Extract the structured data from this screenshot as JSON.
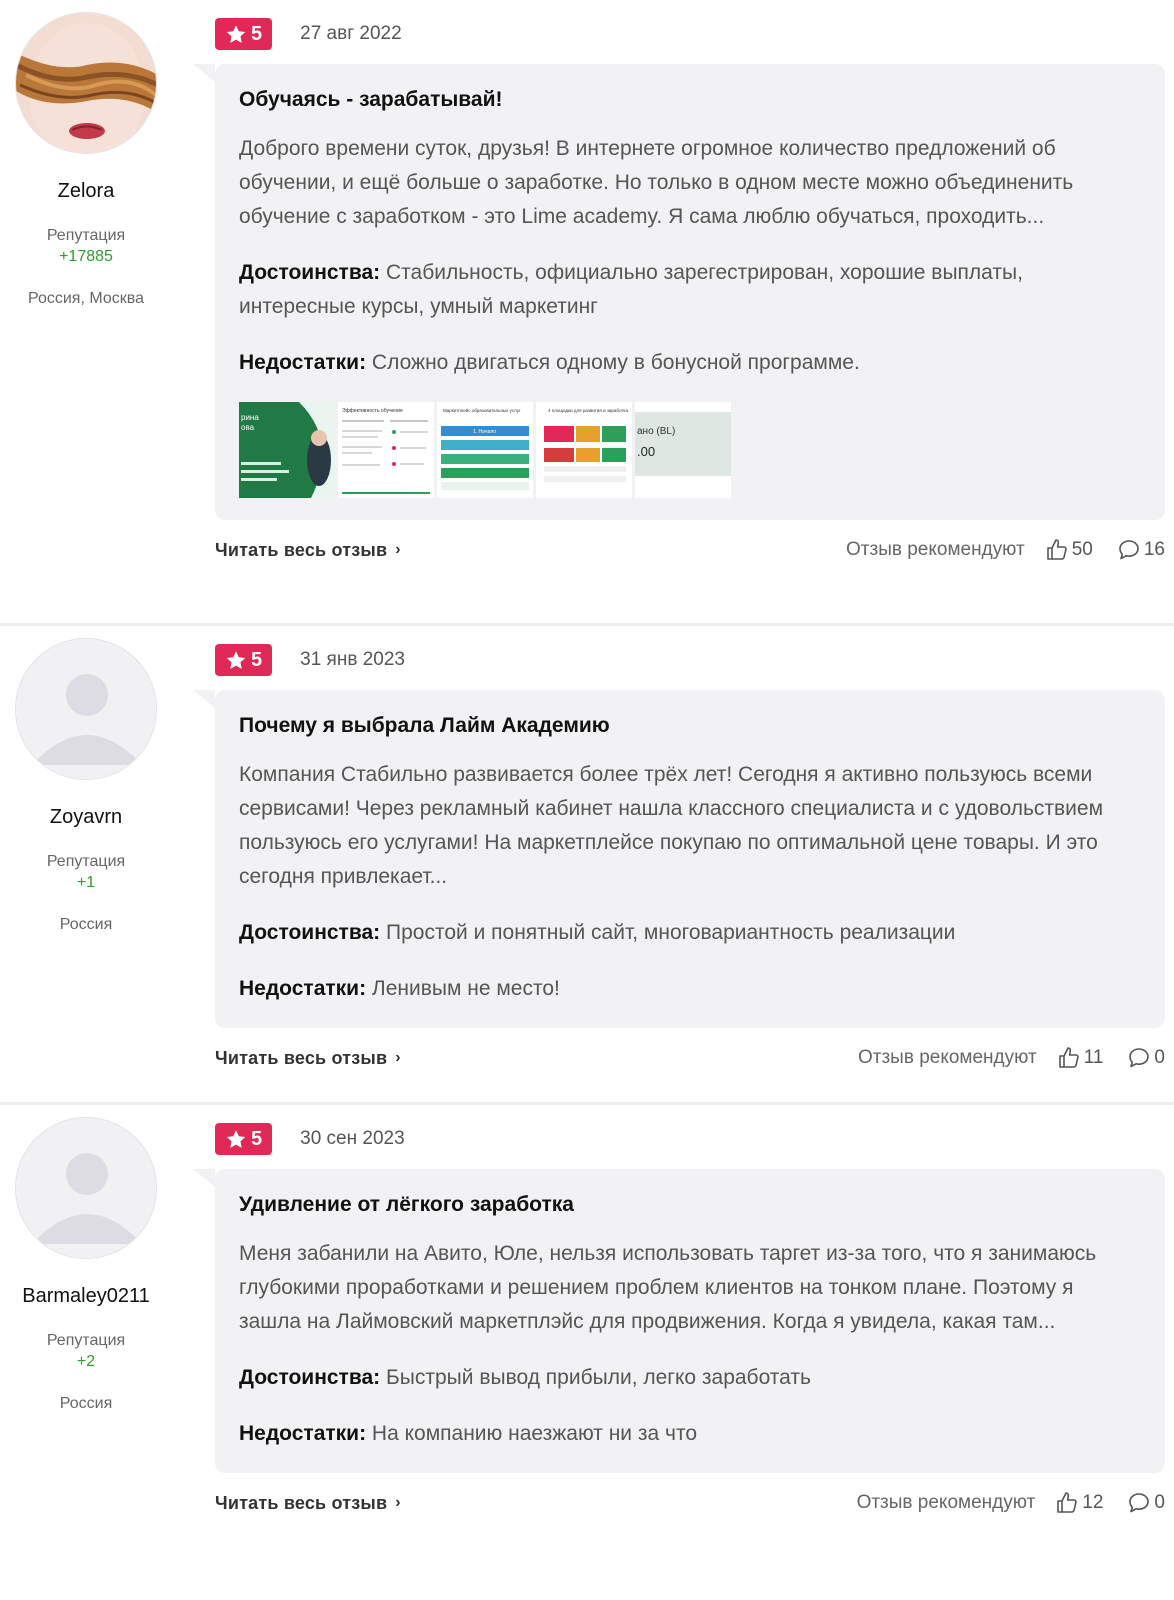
{
  "reviews": [
    {
      "author": {
        "name": "Zelora",
        "reputation_label": "Репутация",
        "reputation": "+17885",
        "location": "Россия, Москва",
        "avatar": "photo"
      },
      "rating": "5",
      "date": "27 авг 2022",
      "title": "Обучаясь - зарабатывай!",
      "text": "Доброго времени суток, друзья! В интернете огромное количество предложений об обучении, и ещё больше о заработке. Но только в одном месте можно объединенить обучение с заработком - это Lime academy. Я сама люблю обучаться, проходить...",
      "pros_label": "Достоинства:",
      "pros": "Стабильность, официально зарегестрирован, хорошие выплаты, интересные курсы, умный маркетинг",
      "cons_label": "Недостатки:",
      "cons": "Сложно двигаться одному в бонусной программе.",
      "read_more": "Читать весь отзыв",
      "recommend_label": "Отзыв рекомендуют",
      "likes": "50",
      "comments": "16",
      "thumbnails": [
        {
          "text_a": "рина",
          "text_b": "ова"
        },
        {
          "text_a": "Эффективность обучения",
          "text_b": ""
        },
        {
          "text_a": "Маркетплейс образовательных услуг",
          "text_b": "1. Начало"
        },
        {
          "text_a": "4 площадки для развития и заработка",
          "text_b": ""
        },
        {
          "text_a": "ано (BL)",
          "text_b": ".00"
        }
      ]
    },
    {
      "author": {
        "name": "Zoyavrn",
        "reputation_label": "Репутация",
        "reputation": "+1",
        "location": "Россия",
        "avatar": "default"
      },
      "rating": "5",
      "date": "31 янв 2023",
      "title": "Почему я выбрала Лайм Академию",
      "text": "Компания Стабильно развивается более трёх лет! Сегодня я активно пользуюсь всеми сервисами! Через рекламный кабинет нашла классного специалиста и с удовольствием пользуюсь его услугами! На маркетплейсе покупаю по оптимальной цене товары. И это сегодня привлекает...",
      "pros_label": "Достоинства:",
      "pros": "Простой и понятный сайт, многовариантность реализации",
      "cons_label": "Недостатки:",
      "cons": "Ленивым не место!",
      "read_more": "Читать весь отзыв",
      "recommend_label": "Отзыв рекомендуют",
      "likes": "11",
      "comments": "0"
    },
    {
      "author": {
        "name": "Barmaley0211",
        "reputation_label": "Репутация",
        "reputation": "+2",
        "location": "Россия",
        "avatar": "default"
      },
      "rating": "5",
      "date": "30 сен 2023",
      "title": "Удивление от лёгкого заработка",
      "text": "Меня забанили на Авито, Юле, нельзя использовать таргет из-за того, что я занимаюсь глубокими проработками и решением проблем клиентов на тонком плане. Поэтому я зашла на Лаймовский маркетплэйс для продвижения. Когда я увидела, какая там...",
      "pros_label": "Достоинства:",
      "pros": "Быстрый вывод прибыли, легко заработать",
      "cons_label": "Недостатки:",
      "cons": "На компанию наезжают ни за что",
      "read_more": "Читать весь отзыв",
      "recommend_label": "Отзыв рекомендуют",
      "likes": "12",
      "comments": "0"
    }
  ],
  "colors": {
    "rating_badge": "#e02956",
    "reputation": "#2e9e2e",
    "card_bg": "#f2f2f4"
  },
  "icons": [
    "star-icon",
    "thumbs-up-icon",
    "comment-icon",
    "chevron-right-icon",
    "default-avatar-icon"
  ]
}
